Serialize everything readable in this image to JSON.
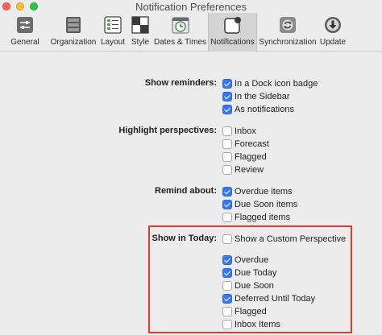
{
  "window": {
    "title": "Notification Preferences"
  },
  "toolbar": {
    "items": [
      {
        "label": "General",
        "icon": "switches-icon"
      },
      {
        "label": "Organization",
        "icon": "drawers-icon"
      },
      {
        "label": "Layout",
        "icon": "layout-icon"
      },
      {
        "label": "Style",
        "icon": "style-icon"
      },
      {
        "label": "Dates & Times",
        "icon": "calendar-clock-icon"
      },
      {
        "label": "Notifications",
        "icon": "notification-icon",
        "selected": true
      },
      {
        "label": "Synchronization",
        "icon": "sync-icon"
      },
      {
        "label": "Update",
        "icon": "download-icon"
      }
    ]
  },
  "sections": {
    "reminders": {
      "label": "Show reminders:",
      "options": [
        {
          "label": "In a Dock icon badge",
          "checked": true
        },
        {
          "label": "In the Sidebar",
          "checked": true
        },
        {
          "label": "As notifications",
          "checked": true
        }
      ]
    },
    "highlight": {
      "label": "Highlight perspectives:",
      "options": [
        {
          "label": "Inbox",
          "checked": false
        },
        {
          "label": "Forecast",
          "checked": false
        },
        {
          "label": "Flagged",
          "checked": false
        },
        {
          "label": "Review",
          "checked": false
        }
      ]
    },
    "remind": {
      "label": "Remind about:",
      "options": [
        {
          "label": "Overdue items",
          "checked": true
        },
        {
          "label": "Due Soon items",
          "checked": true
        },
        {
          "label": "Flagged items",
          "checked": false
        }
      ]
    },
    "today": {
      "label": "Show in Today:",
      "options": [
        {
          "label": "Show a Custom Perspective",
          "checked": false
        },
        {
          "label": "Overdue",
          "checked": true
        },
        {
          "label": "Due Today",
          "checked": true
        },
        {
          "label": "Due Soon",
          "checked": false
        },
        {
          "label": "Deferred Until Today",
          "checked": true
        },
        {
          "label": "Flagged",
          "checked": false
        },
        {
          "label": "Inbox Items",
          "checked": false
        }
      ]
    }
  },
  "colors": {
    "accent": "#3479f6",
    "annotation": "#e03c2e",
    "window_bg": "#ececec"
  }
}
